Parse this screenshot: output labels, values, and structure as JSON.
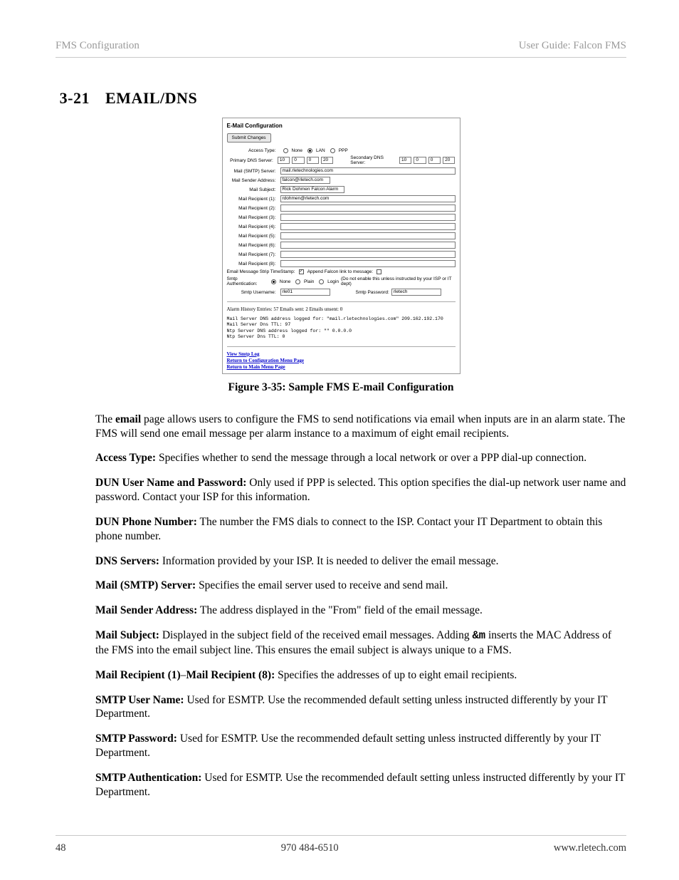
{
  "header": {
    "left": "FMS Configuration",
    "right": "User Guide: Falcon FMS"
  },
  "section": {
    "num": "3-21",
    "title": "EMAIL/DNS"
  },
  "figure": {
    "caption": "Figure 3-35: Sample FMS E-mail Configuration",
    "panel_title": "E-Mail Configuration",
    "submit": "Submit Changes",
    "access_type_label": "Access Type:",
    "access_opts": {
      "none": "None",
      "lan": "LAN",
      "ppp": "PPP"
    },
    "primary_dns_label": "Primary DNS Server:",
    "secondary_dns_label": "Secondary DNS Server:",
    "primary_dns": [
      "10",
      "0",
      "0",
      "20"
    ],
    "secondary_dns": [
      "10",
      "0",
      "0",
      "20"
    ],
    "smtp_server_label": "Mail (SMTP) Server:",
    "smtp_server": "mail.rletechnologies.com",
    "sender_label": "Mail Sender Address:",
    "sender": "falcon@rletech.com",
    "subject_label": "Mail Subject:",
    "subject": "Rick Dohmen Falcon Alarm",
    "recip_labels": [
      "Mail Recipient (1):",
      "Mail Recipient (2):",
      "Mail Recipient (3):",
      "Mail Recipient (4):",
      "Mail Recipient (5):",
      "Mail Recipient (6):",
      "Mail Recipient (7):",
      "Mail Recipient (8):"
    ],
    "recip1": "rdohmen@rletech.com",
    "strip_ts_label": "Email Message Strip TimeStamp:",
    "append_label": "Append Falcon link to message:",
    "auth_label": "Smtp Authentication:",
    "auth_opts": {
      "none": "None",
      "plain": "Plain",
      "login": "Login"
    },
    "auth_hint": "(Do not enable this unless instructed by your ISP or IT dept)",
    "user_label": "Smtp Username:",
    "user_val": "rle01",
    "pass_label": "Smtp Password:",
    "pass_val": "rletech",
    "alarm_history": "Alarm History Entries: 57 Emails sent: 2 Emails unsent: 0",
    "log_text": "Mail Server DNS address logged for: \"mail.rletechnologies.com\" 209.162.192.170\nMail Server Dns TTL: 97\nNtp Server DNS address logged for: \"\" 0.0.0.0\nNtp Server Dns TTL: 0",
    "links": {
      "l1": "View Smtp Log",
      "l2": "Return to Configuration Menu Page",
      "l3": "Return to Main Menu Page"
    }
  },
  "body": {
    "p1a": "The ",
    "p1b": "email",
    "p1c": " page allows users to configure the FMS to send notifications via email when inputs are in an alarm state. The FMS will send one email message per alarm instance to a maximum of eight email recipients.",
    "p2a": "Access Type:",
    "p2b": "  Specifies whether to send the message through a local network or over a PPP dial-up connection.",
    "p3a": "DUN User Name and Password:",
    "p3b": "  Only used if PPP is selected. This option specifies the dial-up network user name and password. Contact your ISP for this information.",
    "p4a": "DUN Phone Number:",
    "p4b": "  The number the FMS dials to connect to the ISP. Contact your IT Department to obtain this phone number.",
    "p5a": "DNS Servers:",
    "p5b": "  Information provided by your ISP. It is needed to deliver the email message.",
    "p6a": "Mail (SMTP) Server:",
    "p6b": "  Specifies the email server used to receive and send mail.",
    "p7a": "Mail Sender Address:",
    "p7b": "  The address displayed in the \"From\" field of the email message.",
    "p8a": "Mail Subject:",
    "p8b": "  Displayed in the subject field of the received email messages. Adding ",
    "p8c": "&m",
    "p8d": " inserts the MAC Address of the FMS into the email subject line. This ensures the email subject is always unique to a FMS.",
    "p9a": "Mail Recipient (1)",
    "p9b": "–",
    "p9c": "Mail Recipient (8):",
    "p9d": "  Specifies the addresses of up to eight email recipients.",
    "p10a": "SMTP User Name:",
    "p10b": "  Used for ESMTP. Use the recommended default setting unless instructed differently by your IT Department.",
    "p11a": "SMTP Password:",
    "p11b": "  Used for ESMTP. Use the recommended default setting unless instructed differently by your IT Department.",
    "p12a": "SMTP Authentication:",
    "p12b": "  Used for ESMTP. Use the recommended default setting unless instructed differently by your IT Department."
  },
  "footer": {
    "page": "48",
    "phone": "970 484-6510",
    "url": "www.rletech.com"
  }
}
